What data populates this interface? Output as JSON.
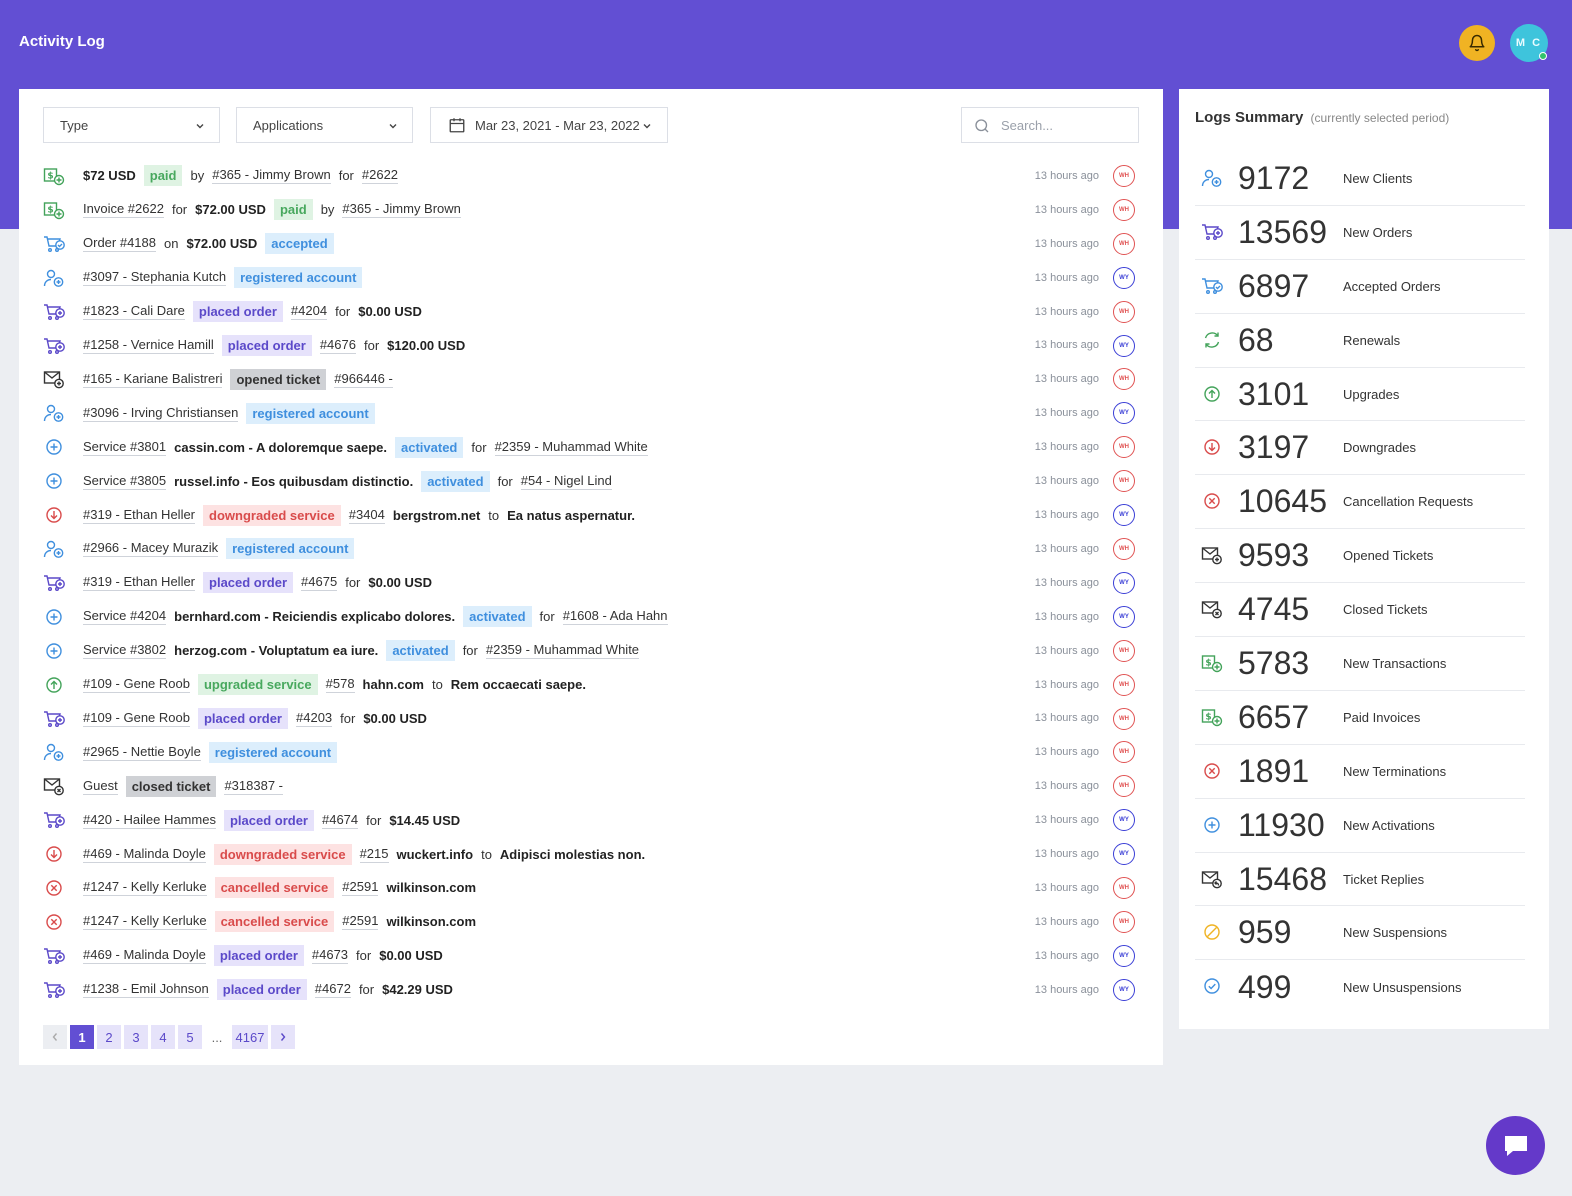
{
  "header": {
    "title": "Activity Log",
    "avatar_initials": "M C",
    "accent": "#624fd3"
  },
  "filters": {
    "type_label": "Type",
    "applications_label": "Applications",
    "date_range": "Mar 23, 2021 - Mar 23, 2022",
    "search_placeholder": "Search..."
  },
  "logs": [
    {
      "icon": "transaction-icon",
      "time": "13 hours ago",
      "user": "WH",
      "parts": [
        {
          "t": "$72 USD",
          "s": "b"
        },
        {
          "t": "paid",
          "s": "badge-green"
        },
        {
          "t": "by"
        },
        {
          "t": "#365 - Jimmy Brown",
          "s": "link"
        },
        {
          "t": "for"
        },
        {
          "t": "#2622",
          "s": "link"
        }
      ]
    },
    {
      "icon": "transaction-icon",
      "time": "13 hours ago",
      "user": "WH",
      "parts": [
        {
          "t": "Invoice #2622",
          "s": "link"
        },
        {
          "t": "for"
        },
        {
          "t": "$72.00 USD",
          "s": "b"
        },
        {
          "t": "paid",
          "s": "badge-green"
        },
        {
          "t": "by"
        },
        {
          "t": "#365 - Jimmy Brown",
          "s": "link"
        }
      ]
    },
    {
      "icon": "accepted-order-icon",
      "time": "13 hours ago",
      "user": "WH",
      "parts": [
        {
          "t": "Order #4188",
          "s": "link"
        },
        {
          "t": "on"
        },
        {
          "t": "$72.00 USD",
          "s": "b"
        },
        {
          "t": "accepted",
          "s": "badge-blue"
        }
      ]
    },
    {
      "icon": "new-client-icon",
      "time": "13 hours ago",
      "user": "WY",
      "parts": [
        {
          "t": "#3097 - Stephania Kutch",
          "s": "link"
        },
        {
          "t": "registered account",
          "s": "badge-blue"
        }
      ]
    },
    {
      "icon": "cart-plus-icon",
      "time": "13 hours ago",
      "user": "WH",
      "parts": [
        {
          "t": "#1823 - Cali Dare",
          "s": "link"
        },
        {
          "t": "placed order",
          "s": "badge-purple"
        },
        {
          "t": "#4204",
          "s": "link"
        },
        {
          "t": "for"
        },
        {
          "t": "$0.00 USD",
          "s": "b"
        }
      ]
    },
    {
      "icon": "cart-plus-icon",
      "time": "13 hours ago",
      "user": "WY",
      "parts": [
        {
          "t": "#1258 - Vernice Hamill",
          "s": "link"
        },
        {
          "t": "placed order",
          "s": "badge-purple"
        },
        {
          "t": "#4676",
          "s": "link"
        },
        {
          "t": "for"
        },
        {
          "t": "$120.00 USD",
          "s": "b"
        }
      ]
    },
    {
      "icon": "ticket-open-icon",
      "time": "13 hours ago",
      "user": "WH",
      "parts": [
        {
          "t": "#165 - Kariane Balistreri",
          "s": "link"
        },
        {
          "t": "opened ticket",
          "s": "badge-gray"
        },
        {
          "t": "#966446 -",
          "s": "link"
        }
      ]
    },
    {
      "icon": "new-client-icon",
      "time": "13 hours ago",
      "user": "WY",
      "parts": [
        {
          "t": "#3096 - Irving Christiansen",
          "s": "link"
        },
        {
          "t": "registered account",
          "s": "badge-blue"
        }
      ]
    },
    {
      "icon": "activation-icon",
      "time": "13 hours ago",
      "user": "WH",
      "parts": [
        {
          "t": "Service #3801",
          "s": "link"
        },
        {
          "t": "cassin.com - A doloremque saepe.",
          "s": "b"
        },
        {
          "t": "activated",
          "s": "badge-blue"
        },
        {
          "t": "for"
        },
        {
          "t": "#2359 - Muhammad White",
          "s": "link"
        }
      ]
    },
    {
      "icon": "activation-icon",
      "time": "13 hours ago",
      "user": "WH",
      "parts": [
        {
          "t": "Service #3805",
          "s": "link"
        },
        {
          "t": "russel.info - Eos quibusdam distinctio.",
          "s": "b"
        },
        {
          "t": "activated",
          "s": "badge-blue"
        },
        {
          "t": "for"
        },
        {
          "t": "#54 - Nigel Lind",
          "s": "link"
        }
      ]
    },
    {
      "icon": "downgrade-icon",
      "time": "13 hours ago",
      "user": "WY",
      "parts": [
        {
          "t": "#319 - Ethan Heller",
          "s": "link"
        },
        {
          "t": "downgraded service",
          "s": "badge-red"
        },
        {
          "t": "#3404",
          "s": "link"
        },
        {
          "t": "bergstrom.net",
          "s": "b"
        },
        {
          "t": "to"
        },
        {
          "t": "Ea natus aspernatur.",
          "s": "b"
        }
      ]
    },
    {
      "icon": "new-client-icon",
      "time": "13 hours ago",
      "user": "WH",
      "parts": [
        {
          "t": "#2966 - Macey Murazik",
          "s": "link"
        },
        {
          "t": "registered account",
          "s": "badge-blue"
        }
      ]
    },
    {
      "icon": "cart-plus-icon",
      "time": "13 hours ago",
      "user": "WY",
      "parts": [
        {
          "t": "#319 - Ethan Heller",
          "s": "link"
        },
        {
          "t": "placed order",
          "s": "badge-purple"
        },
        {
          "t": "#4675",
          "s": "link"
        },
        {
          "t": "for"
        },
        {
          "t": "$0.00 USD",
          "s": "b"
        }
      ]
    },
    {
      "icon": "activation-icon",
      "time": "13 hours ago",
      "user": "WY",
      "parts": [
        {
          "t": "Service #4204",
          "s": "link"
        },
        {
          "t": "bernhard.com - Reiciendis explicabo dolores.",
          "s": "b"
        },
        {
          "t": "activated",
          "s": "badge-blue"
        },
        {
          "t": "for"
        },
        {
          "t": "#1608 - Ada Hahn",
          "s": "link"
        }
      ]
    },
    {
      "icon": "activation-icon",
      "time": "13 hours ago",
      "user": "WH",
      "parts": [
        {
          "t": "Service #3802",
          "s": "link"
        },
        {
          "t": "herzog.com - Voluptatum ea iure.",
          "s": "b"
        },
        {
          "t": "activated",
          "s": "badge-blue"
        },
        {
          "t": "for"
        },
        {
          "t": "#2359 - Muhammad White",
          "s": "link"
        }
      ]
    },
    {
      "icon": "upgrade-icon",
      "time": "13 hours ago",
      "user": "WH",
      "parts": [
        {
          "t": "#109 - Gene Roob",
          "s": "link"
        },
        {
          "t": "upgraded service",
          "s": "badge-green"
        },
        {
          "t": "#578",
          "s": "link"
        },
        {
          "t": "hahn.com",
          "s": "b"
        },
        {
          "t": "to"
        },
        {
          "t": "Rem occaecati saepe.",
          "s": "b"
        }
      ]
    },
    {
      "icon": "cart-plus-icon",
      "time": "13 hours ago",
      "user": "WH",
      "parts": [
        {
          "t": "#109 - Gene Roob",
          "s": "link"
        },
        {
          "t": "placed order",
          "s": "badge-purple"
        },
        {
          "t": "#4203",
          "s": "link"
        },
        {
          "t": "for"
        },
        {
          "t": "$0.00 USD",
          "s": "b"
        }
      ]
    },
    {
      "icon": "new-client-icon",
      "time": "13 hours ago",
      "user": "WH",
      "parts": [
        {
          "t": "#2965 - Nettie Boyle",
          "s": "link"
        },
        {
          "t": "registered account",
          "s": "badge-blue"
        }
      ]
    },
    {
      "icon": "ticket-closed-icon",
      "time": "13 hours ago",
      "user": "WH",
      "parts": [
        {
          "t": "Guest",
          "s": "link"
        },
        {
          "t": "closed ticket",
          "s": "badge-gray"
        },
        {
          "t": "#318387 -",
          "s": "link"
        }
      ]
    },
    {
      "icon": "cart-plus-icon",
      "time": "13 hours ago",
      "user": "WY",
      "parts": [
        {
          "t": "#420 - Hailee Hammes",
          "s": "link"
        },
        {
          "t": "placed order",
          "s": "badge-purple"
        },
        {
          "t": "#4674",
          "s": "link"
        },
        {
          "t": "for"
        },
        {
          "t": "$14.45 USD",
          "s": "b"
        }
      ]
    },
    {
      "icon": "downgrade-icon",
      "time": "13 hours ago",
      "user": "WY",
      "parts": [
        {
          "t": "#469 - Malinda Doyle",
          "s": "link"
        },
        {
          "t": "downgraded service",
          "s": "badge-red"
        },
        {
          "t": "#215",
          "s": "link"
        },
        {
          "t": "wuckert.info",
          "s": "b"
        },
        {
          "t": "to"
        },
        {
          "t": "Adipisci molestias non.",
          "s": "b"
        }
      ]
    },
    {
      "icon": "cancel-icon",
      "time": "13 hours ago",
      "user": "WH",
      "parts": [
        {
          "t": "#1247 - Kelly Kerluke",
          "s": "link"
        },
        {
          "t": "cancelled service",
          "s": "badge-red"
        },
        {
          "t": "#2591",
          "s": "link"
        },
        {
          "t": "wilkinson.com",
          "s": "b"
        }
      ]
    },
    {
      "icon": "cancel-icon",
      "time": "13 hours ago",
      "user": "WH",
      "parts": [
        {
          "t": "#1247 - Kelly Kerluke",
          "s": "link"
        },
        {
          "t": "cancelled service",
          "s": "badge-red"
        },
        {
          "t": "#2591",
          "s": "link"
        },
        {
          "t": "wilkinson.com",
          "s": "b"
        }
      ]
    },
    {
      "icon": "cart-plus-icon",
      "time": "13 hours ago",
      "user": "WY",
      "parts": [
        {
          "t": "#469 - Malinda Doyle",
          "s": "link"
        },
        {
          "t": "placed order",
          "s": "badge-purple"
        },
        {
          "t": "#4673",
          "s": "link"
        },
        {
          "t": "for"
        },
        {
          "t": "$0.00 USD",
          "s": "b"
        }
      ]
    },
    {
      "icon": "cart-plus-icon",
      "time": "13 hours ago",
      "user": "WY",
      "parts": [
        {
          "t": "#1238 - Emil Johnson",
          "s": "link"
        },
        {
          "t": "placed order",
          "s": "badge-purple"
        },
        {
          "t": "#4672",
          "s": "link"
        },
        {
          "t": "for"
        },
        {
          "t": "$42.29 USD",
          "s": "b"
        }
      ]
    }
  ],
  "pagination": {
    "pages": [
      "1",
      "2",
      "3",
      "4",
      "5"
    ],
    "ellipsis": "...",
    "last": "4167",
    "current": "1"
  },
  "summary": {
    "title": "Logs Summary",
    "subtitle": "(currently selected period)",
    "stats": [
      {
        "icon": "new-client-icon",
        "value": "9172",
        "label": "New Clients"
      },
      {
        "icon": "cart-plus-icon",
        "value": "13569",
        "label": "New Orders"
      },
      {
        "icon": "accepted-order-icon",
        "value": "6897",
        "label": "Accepted Orders"
      },
      {
        "icon": "renewal-icon",
        "value": "68",
        "label": "Renewals"
      },
      {
        "icon": "upgrade-icon",
        "value": "3101",
        "label": "Upgrades"
      },
      {
        "icon": "downgrade-icon",
        "value": "3197",
        "label": "Downgrades"
      },
      {
        "icon": "cancel-icon",
        "value": "10645",
        "label": "Cancellation Requests"
      },
      {
        "icon": "ticket-open-icon",
        "value": "9593",
        "label": "Opened Tickets"
      },
      {
        "icon": "ticket-closed-icon",
        "value": "4745",
        "label": "Closed Tickets"
      },
      {
        "icon": "transaction-icon",
        "value": "5783",
        "label": "New Transactions"
      },
      {
        "icon": "transaction-icon",
        "value": "6657",
        "label": "Paid Invoices"
      },
      {
        "icon": "cancel-icon",
        "value": "1891",
        "label": "New Terminations"
      },
      {
        "icon": "activation-icon",
        "value": "11930",
        "label": "New Activations"
      },
      {
        "icon": "ticket-reply-icon",
        "value": "15468",
        "label": "Ticket Replies"
      },
      {
        "icon": "suspension-icon",
        "value": "959",
        "label": "New Suspensions"
      },
      {
        "icon": "unsuspension-icon",
        "value": "499",
        "label": "New Unsuspensions"
      }
    ]
  }
}
